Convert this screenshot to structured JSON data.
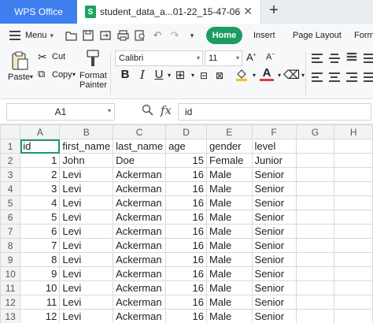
{
  "tabs": {
    "app_label": "WPS Office",
    "doc_title": "student_data_a...01-22_15-47-06",
    "doc_icon_letter": "S",
    "close_glyph": "✕",
    "add_glyph": "+"
  },
  "menu": {
    "menu_label": "Menu",
    "ribbon_tabs": [
      "Home",
      "Insert",
      "Page Layout",
      "Formu"
    ]
  },
  "ribbon": {
    "paste_label": "Paste",
    "cut_label": "Cut",
    "copy_label": "Copy",
    "format_painter_label": "Format\nPainter",
    "font_name": "Calibri",
    "font_size": "11",
    "accent_green": "#1c9c64"
  },
  "formula_bar": {
    "cell_ref": "A1",
    "fx_label": "fx",
    "value": "id"
  },
  "sheet": {
    "column_letters": [
      "A",
      "B",
      "C",
      "D",
      "E",
      "F",
      "G",
      "H"
    ],
    "header": [
      "id",
      "first_name",
      "last_name",
      "age",
      "gender",
      "level"
    ],
    "rows": [
      [
        "1",
        "John",
        "Doe",
        "15",
        "Female",
        "Junior"
      ],
      [
        "2",
        "Levi",
        "Ackerman",
        "16",
        "Male",
        "Senior"
      ],
      [
        "3",
        "Levi",
        "Ackerman",
        "16",
        "Male",
        "Senior"
      ],
      [
        "4",
        "Levi",
        "Ackerman",
        "16",
        "Male",
        "Senior"
      ],
      [
        "5",
        "Levi",
        "Ackerman",
        "16",
        "Male",
        "Senior"
      ],
      [
        "6",
        "Levi",
        "Ackerman",
        "16",
        "Male",
        "Senior"
      ],
      [
        "7",
        "Levi",
        "Ackerman",
        "16",
        "Male",
        "Senior"
      ],
      [
        "8",
        "Levi",
        "Ackerman",
        "16",
        "Male",
        "Senior"
      ],
      [
        "9",
        "Levi",
        "Ackerman",
        "16",
        "Male",
        "Senior"
      ],
      [
        "10",
        "Levi",
        "Ackerman",
        "16",
        "Male",
        "Senior"
      ],
      [
        "11",
        "Levi",
        "Ackerman",
        "16",
        "Male",
        "Senior"
      ],
      [
        "12",
        "Levi",
        "Ackerman",
        "16",
        "Male",
        "Senior"
      ]
    ],
    "row_numbers": [
      "1",
      "2",
      "3",
      "4",
      "5",
      "6",
      "7",
      "8",
      "9",
      "10",
      "11",
      "12",
      "13"
    ],
    "active_cell": "A1"
  }
}
